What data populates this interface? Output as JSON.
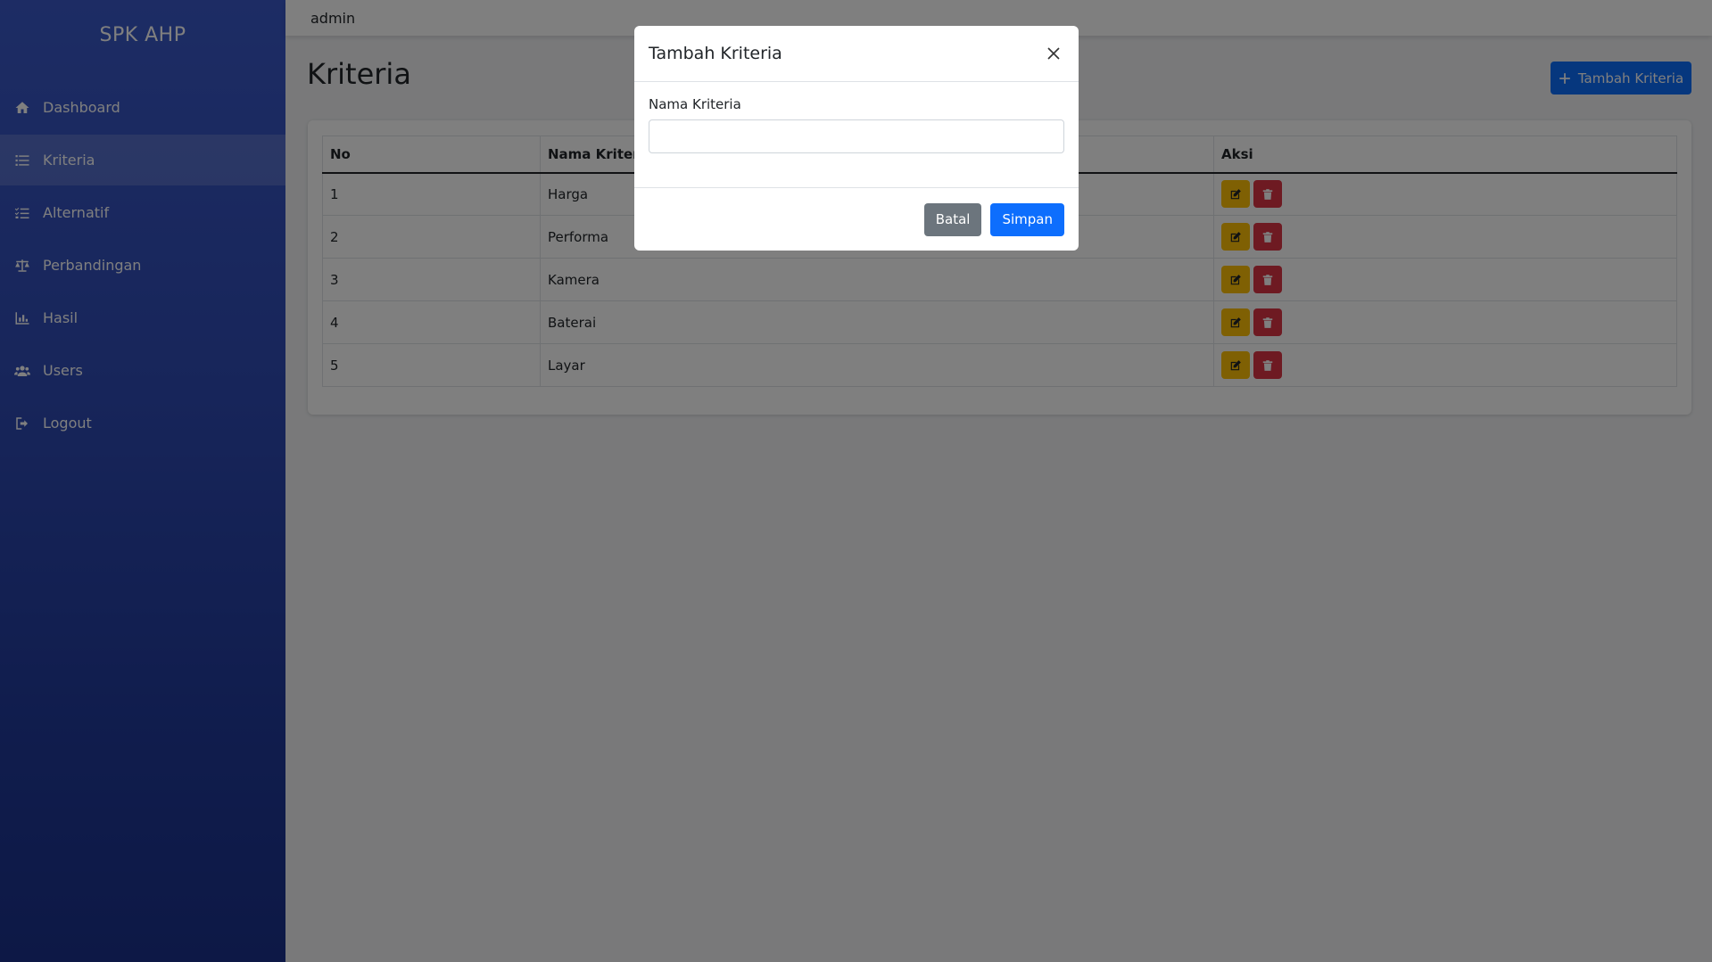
{
  "sidebar": {
    "brand": "SPK AHP",
    "items": [
      {
        "label": "Dashboard",
        "icon": "home-icon"
      },
      {
        "label": "Kriteria",
        "icon": "list-icon",
        "active": true
      },
      {
        "label": "Alternatif",
        "icon": "list-check-icon"
      },
      {
        "label": "Perbandingan",
        "icon": "balance-scale-icon"
      },
      {
        "label": "Hasil",
        "icon": "chart-icon"
      },
      {
        "label": "Users",
        "icon": "users-icon"
      },
      {
        "label": "Logout",
        "icon": "logout-icon"
      }
    ]
  },
  "topbar": {
    "user": "admin"
  },
  "main": {
    "title": "Kriteria",
    "add_button": "Tambah Kriteria",
    "table": {
      "headers": [
        "No",
        "Nama Kriteria",
        "Aksi"
      ],
      "rows": [
        {
          "no": "1",
          "nama": "Harga"
        },
        {
          "no": "2",
          "nama": "Performa"
        },
        {
          "no": "3",
          "nama": "Kamera"
        },
        {
          "no": "4",
          "nama": "Baterai"
        },
        {
          "no": "5",
          "nama": "Layar"
        }
      ]
    }
  },
  "modal": {
    "title": "Tambah Kriteria",
    "field_label": "Nama Kriteria",
    "field_value": "",
    "cancel": "Batal",
    "save": "Simpan"
  },
  "colors": {
    "primary": "#0d6efd",
    "warning": "#ffc107",
    "danger": "#dc3545",
    "secondary": "#6c757d",
    "sidebar": "#2f4bb5"
  }
}
